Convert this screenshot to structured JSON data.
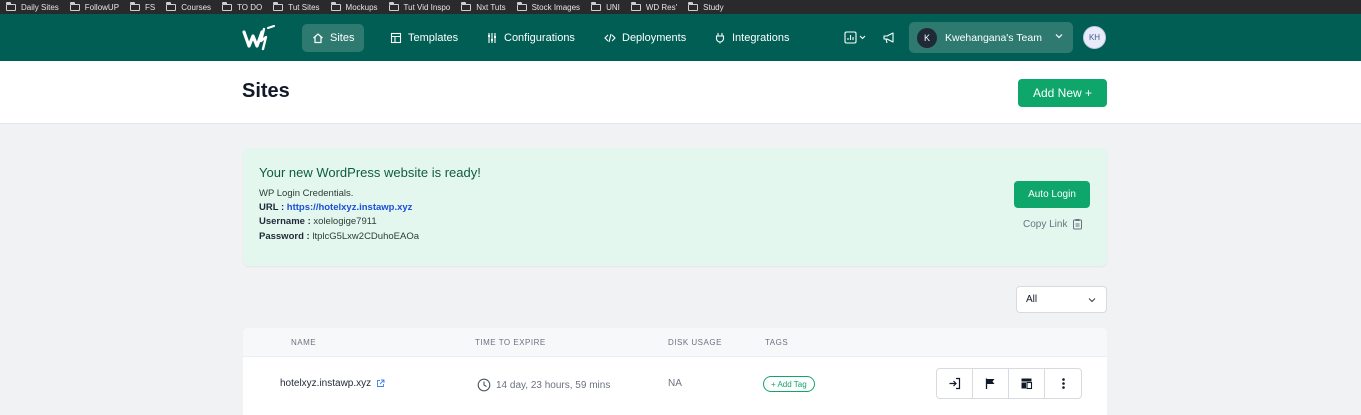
{
  "bookmarks": [
    "Daily Sites",
    "FollowUP",
    "FS",
    "Courses",
    "TO DO",
    "Tut Sites",
    "Mockups",
    "Tut Vid Inspo",
    "Nxt Tuts",
    "Stock Images",
    "UNI",
    "WD Res'",
    "Study"
  ],
  "nav": {
    "items": [
      {
        "label": "Sites",
        "icon": "home-icon"
      },
      {
        "label": "Templates",
        "icon": "template-icon"
      },
      {
        "label": "Configurations",
        "icon": "sliders-icon"
      },
      {
        "label": "Deployments",
        "icon": "code-icon"
      },
      {
        "label": "Integrations",
        "icon": "plug-icon"
      }
    ],
    "team": {
      "initial": "K",
      "name": "Kwehangana's Team"
    },
    "avatar": "KH",
    "brand_color": "#005e54"
  },
  "header": {
    "title": "Sites",
    "add_new_label": "Add New +"
  },
  "notice": {
    "title": "Your new WordPress website is ready!",
    "subtitle": "WP Login Credentials.",
    "url_label": "URL :",
    "url": "https://hotelxyz.instawp.xyz",
    "username_label": "Username :",
    "username": "xolelogige7911",
    "password_label": "Password :",
    "password": "ltplcG5Lxw2CDuhoEAOa",
    "auto_login_label": "Auto Login",
    "copy_link_label": "Copy Link"
  },
  "filter": {
    "selected": "All"
  },
  "table": {
    "headers": [
      "NAME",
      "TIME TO EXPIRE",
      "DISK USAGE",
      "TAGS"
    ],
    "rows": [
      {
        "name": "hotelxyz.instawp.xyz",
        "expire": "14 day, 23 hours, 59 mins",
        "disk": "NA",
        "tag_label": "+ Add Tag"
      }
    ]
  },
  "colors": {
    "accent": "#0ea66b",
    "notice_bg": "#e3f7ef"
  }
}
